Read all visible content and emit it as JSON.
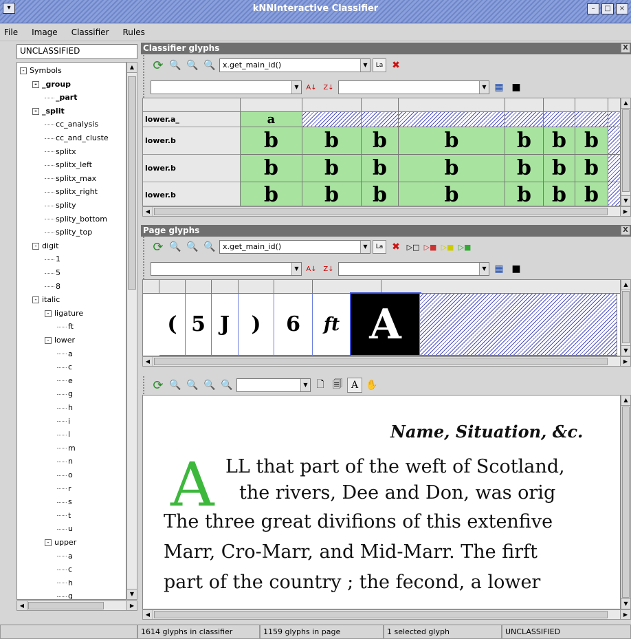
{
  "window": {
    "title": "kNNInteractive Classifier"
  },
  "menu": [
    "File",
    "Image",
    "Classifier",
    "Rules"
  ],
  "left": {
    "class_input": "UNCLASSIFIED",
    "tree": [
      {
        "label": "Symbols",
        "depth": 0,
        "exp": "-",
        "bold": false
      },
      {
        "label": "_group",
        "depth": 1,
        "exp": "-",
        "bold": true
      },
      {
        "label": "_part",
        "depth": 2,
        "exp": "",
        "bold": true
      },
      {
        "label": "_split",
        "depth": 1,
        "exp": "-",
        "bold": true
      },
      {
        "label": "cc_analysis",
        "depth": 2,
        "exp": "",
        "bold": false
      },
      {
        "label": "cc_and_cluste",
        "depth": 2,
        "exp": "",
        "bold": false
      },
      {
        "label": "splitx",
        "depth": 2,
        "exp": "",
        "bold": false
      },
      {
        "label": "splitx_left",
        "depth": 2,
        "exp": "",
        "bold": false
      },
      {
        "label": "splitx_max",
        "depth": 2,
        "exp": "",
        "bold": false
      },
      {
        "label": "splitx_right",
        "depth": 2,
        "exp": "",
        "bold": false
      },
      {
        "label": "splity",
        "depth": 2,
        "exp": "",
        "bold": false
      },
      {
        "label": "splity_bottom",
        "depth": 2,
        "exp": "",
        "bold": false
      },
      {
        "label": "splity_top",
        "depth": 2,
        "exp": "",
        "bold": false
      },
      {
        "label": "digit",
        "depth": 1,
        "exp": "-",
        "bold": false
      },
      {
        "label": "1",
        "depth": 2,
        "exp": "",
        "bold": false
      },
      {
        "label": "5",
        "depth": 2,
        "exp": "",
        "bold": false
      },
      {
        "label": "8",
        "depth": 2,
        "exp": "",
        "bold": false
      },
      {
        "label": "italic",
        "depth": 1,
        "exp": "-",
        "bold": false
      },
      {
        "label": "ligature",
        "depth": 2,
        "exp": "-",
        "bold": false
      },
      {
        "label": "ft",
        "depth": 3,
        "exp": "",
        "bold": false
      },
      {
        "label": "lower",
        "depth": 2,
        "exp": "-",
        "bold": false
      },
      {
        "label": "a",
        "depth": 3,
        "exp": "",
        "bold": false
      },
      {
        "label": "c",
        "depth": 3,
        "exp": "",
        "bold": false
      },
      {
        "label": "e",
        "depth": 3,
        "exp": "",
        "bold": false
      },
      {
        "label": "g",
        "depth": 3,
        "exp": "",
        "bold": false
      },
      {
        "label": "h",
        "depth": 3,
        "exp": "",
        "bold": false
      },
      {
        "label": "i",
        "depth": 3,
        "exp": "",
        "bold": false
      },
      {
        "label": "l",
        "depth": 3,
        "exp": "",
        "bold": false
      },
      {
        "label": "m",
        "depth": 3,
        "exp": "",
        "bold": false
      },
      {
        "label": "n",
        "depth": 3,
        "exp": "",
        "bold": false
      },
      {
        "label": "o",
        "depth": 3,
        "exp": "",
        "bold": false
      },
      {
        "label": "r",
        "depth": 3,
        "exp": "",
        "bold": false
      },
      {
        "label": "s",
        "depth": 3,
        "exp": "",
        "bold": false
      },
      {
        "label": "t",
        "depth": 3,
        "exp": "",
        "bold": false
      },
      {
        "label": "u",
        "depth": 3,
        "exp": "",
        "bold": false
      },
      {
        "label": "upper",
        "depth": 2,
        "exp": "-",
        "bold": false
      },
      {
        "label": "a",
        "depth": 3,
        "exp": "",
        "bold": false
      },
      {
        "label": "c",
        "depth": 3,
        "exp": "",
        "bold": false
      },
      {
        "label": "h",
        "depth": 3,
        "exp": "",
        "bold": false
      },
      {
        "label": "q",
        "depth": 3,
        "exp": "",
        "bold": false
      }
    ]
  },
  "classifier_panel": {
    "title": "Classifier glyphs",
    "close": "X",
    "sort_combo": "x.get_main_id()",
    "label_btn": "La",
    "rows": [
      {
        "label": "lower.a_",
        "glyphs": [
          "a"
        ]
      },
      {
        "label": "lower.b",
        "glyphs": [
          "b",
          "b",
          "b",
          "b",
          "b",
          "b",
          "b"
        ]
      },
      {
        "label": "lower.b",
        "glyphs": [
          "b",
          "b",
          "b",
          "b",
          "b",
          "b",
          "b"
        ]
      },
      {
        "label": "lower.b",
        "glyphs": [
          "b",
          "b",
          "b",
          "b",
          "b",
          "b",
          "b"
        ]
      }
    ]
  },
  "page_panel": {
    "title": "Page glyphs",
    "close": "X",
    "sort_combo": "x.get_main_id()",
    "label_btn": "La",
    "glyphs": [
      "(",
      "5",
      "J",
      ")",
      "6",
      "ft",
      "A"
    ]
  },
  "page_text": {
    "lines": [
      "Name, Situation, &c.",
      "LL that part of the weft of Scotland,",
      "the rivers, Dee and Don, was orig",
      "The three great divifions of this extenfive",
      "Marr, Cro-Marr, and Mid-Marr.  The firft",
      "part of the country ; the fecond, a lower"
    ],
    "dropcap": "A"
  },
  "status": {
    "classifier_count": "1614 glyphs in classifier",
    "page_count": "1159 glyphs in page",
    "selected": "1 selected glyph",
    "class": "UNCLASSIFIED"
  },
  "colors": {
    "green": "#a8e4a0",
    "select_blue": "#3a4fd0",
    "dropcap_green": "#3db83d"
  }
}
